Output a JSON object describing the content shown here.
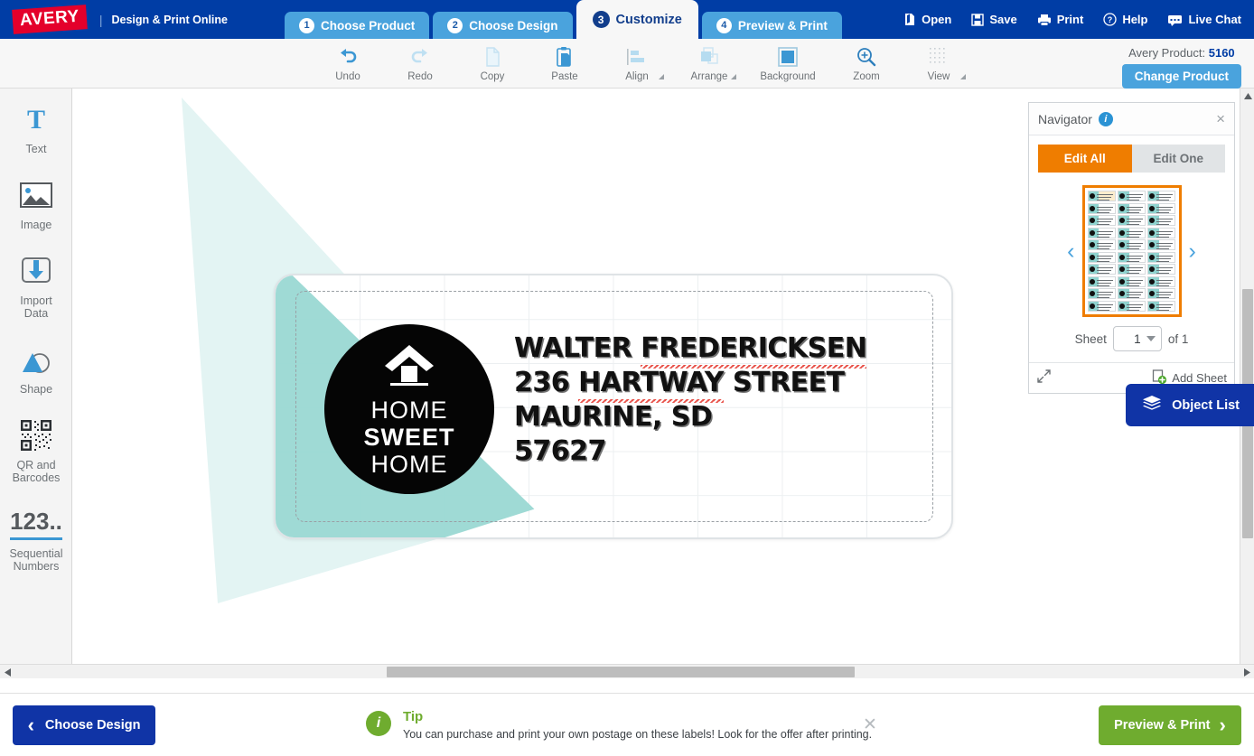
{
  "header": {
    "brand": "AVERY",
    "separator": "|",
    "tagline": "Design & Print Online",
    "tabs": [
      {
        "num": "1",
        "label": "Choose Product",
        "active": false
      },
      {
        "num": "2",
        "label": "Choose Design",
        "active": false
      },
      {
        "num": "3",
        "label": "Customize",
        "active": true
      },
      {
        "num": "4",
        "label": "Preview & Print",
        "active": false
      }
    ],
    "actions": [
      {
        "label": "Open",
        "icon": "open-folder-icon"
      },
      {
        "label": "Save",
        "icon": "floppy-disk-icon"
      },
      {
        "label": "Print",
        "icon": "printer-icon"
      },
      {
        "label": "Help",
        "icon": "question-circle-icon"
      },
      {
        "label": "Live Chat",
        "icon": "chat-bubble-icon"
      }
    ]
  },
  "toolbar": {
    "items": [
      {
        "label": "Undo",
        "icon": "undo-arrow-icon",
        "enabled": true,
        "caret": false
      },
      {
        "label": "Redo",
        "icon": "redo-arrow-icon",
        "enabled": false,
        "caret": false
      },
      {
        "label": "Copy",
        "icon": "copy-page-icon",
        "enabled": false,
        "caret": false
      },
      {
        "label": "Paste",
        "icon": "paste-clipboard-icon",
        "enabled": true,
        "caret": false
      },
      {
        "label": "Align",
        "icon": "align-left-icon",
        "enabled": false,
        "caret": true
      },
      {
        "label": "Arrange",
        "icon": "arrange-layers-icon",
        "enabled": false,
        "caret": true
      },
      {
        "label": "Background",
        "icon": "background-square-icon",
        "enabled": true,
        "caret": false
      },
      {
        "label": "Zoom",
        "icon": "magnifier-plus-icon",
        "enabled": true,
        "caret": false
      },
      {
        "label": "View",
        "icon": "grid-dots-icon",
        "enabled": false,
        "caret": true
      }
    ],
    "product_label": "Avery Product:",
    "product_number": "5160",
    "change_product": "Change Product"
  },
  "sidebar": {
    "items": [
      {
        "label": "Text",
        "icon": "text-t-icon"
      },
      {
        "label": "Image",
        "icon": "image-picture-icon"
      },
      {
        "label": "Import\nData",
        "icon": "import-data-icon"
      },
      {
        "label": "Shape",
        "icon": "shape-triangle-circle-icon"
      },
      {
        "label": "QR and\nBarcodes",
        "icon": "qr-code-icon"
      },
      {
        "label": "Sequential\nNumbers",
        "icon": "sequential-numbers-icon"
      }
    ],
    "sequential_glyph": "123.."
  },
  "label": {
    "badge": {
      "line1": "HOME",
      "line2": "SWEET",
      "line3": "HOME",
      "icon": "house-roof-icon"
    },
    "address_lines": [
      {
        "pre": "WALTER ",
        "misspelled": "FREDERICKSEN",
        "post": ""
      },
      {
        "pre": "236 ",
        "misspelled": "HARTWAY",
        "post": " STREET"
      },
      {
        "pre": "MAURINE, SD",
        "misspelled": "",
        "post": ""
      },
      {
        "pre": "57627",
        "misspelled": "",
        "post": ""
      }
    ],
    "accent_color": "#9ad8d3"
  },
  "navigator": {
    "title": "Navigator",
    "info_glyph": "i",
    "close_glyph": "×",
    "edit_all": "Edit All",
    "edit_one": "Edit One",
    "prev_glyph": "‹",
    "next_glyph": "›",
    "sheet_label": "Sheet",
    "sheet_value": "1",
    "sheet_of": "of 1",
    "add_sheet": "Add Sheet",
    "expand_icon": "expand-diagonal-icon",
    "sheet_rows": 10,
    "sheet_cols": 3
  },
  "object_list": {
    "label": "Object List",
    "icon": "layers-stack-icon"
  },
  "bottom": {
    "choose_design": "Choose Design",
    "choose_chevron": "‹",
    "tip_title": "Tip",
    "tip_body": "You can purchase and print your own postage on these labels! Look for the offer after printing.",
    "tip_close": "✕",
    "preview_print": "Preview & Print",
    "preview_chevron": "›"
  },
  "colors": {
    "header_blue": "#003da5",
    "tab_blue": "#4aa3dd",
    "avery_red": "#e4002b",
    "orange": "#ef7d00",
    "green": "#6fac2f",
    "navy": "#1034a6"
  }
}
